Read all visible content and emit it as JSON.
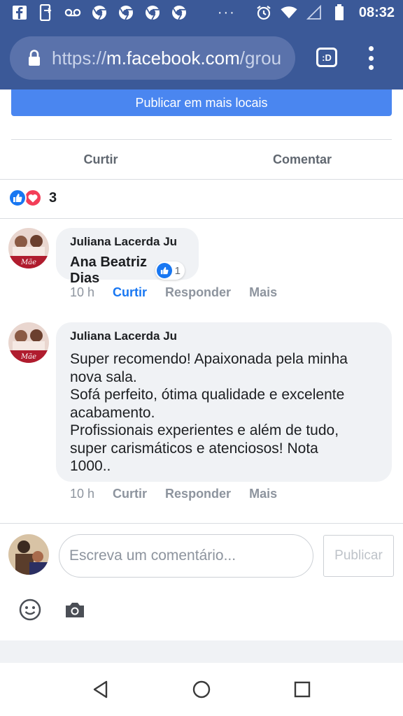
{
  "status_bar": {
    "time": "08:32",
    "dots": "···",
    "left_icons": [
      "facebook-icon",
      "phone-link-icon",
      "voicemail-icon",
      "chrome-icon",
      "chrome-icon",
      "chrome-icon",
      "chrome-icon"
    ],
    "right_icons": [
      "alarm-icon",
      "wifi-icon",
      "signal-icon",
      "battery-icon"
    ]
  },
  "browser": {
    "url_scheme": "https://",
    "url_host": "m.facebook.com",
    "url_path": "/grou",
    "tab_label": ":D"
  },
  "post": {
    "publish_more_label": "Publicar em mais locais",
    "actions": {
      "like_label": "Curtir",
      "comment_label": "Comentar"
    },
    "reaction_count": "3"
  },
  "comments": [
    {
      "author": "Juliana Lacerda Ju",
      "mention": "Ana Beatriz Dias",
      "like_count": "1",
      "meta": {
        "time": "10 h",
        "like": "Curtir",
        "reply": "Responder",
        "more": "Mais"
      }
    },
    {
      "author": "Juliana Lacerda Ju",
      "lines": [
        "Super recomendo! Apaixonada pela minha",
        "nova sala.",
        "Sofá perfeito, ótima qualidade e excelente",
        "acabamento.",
        "Profissionais experientes e além de tudo,",
        "super carismáticos e atenciosos! Nota",
        "1000.."
      ],
      "emoji": "😘",
      "meta": {
        "time": "10 h",
        "like": "Curtir",
        "reply": "Responder",
        "more": "Mais"
      }
    }
  ],
  "avatar_caption": "Mãe",
  "composer": {
    "placeholder": "Escreva um comentário...",
    "publish_label": "Publicar"
  },
  "colors": {
    "facebook_blue": "#3b5998",
    "action_blue": "#4a86f0",
    "like_blue": "#1877f2",
    "love_red": "#f33e58",
    "bubble_gray": "#f0f2f5"
  }
}
